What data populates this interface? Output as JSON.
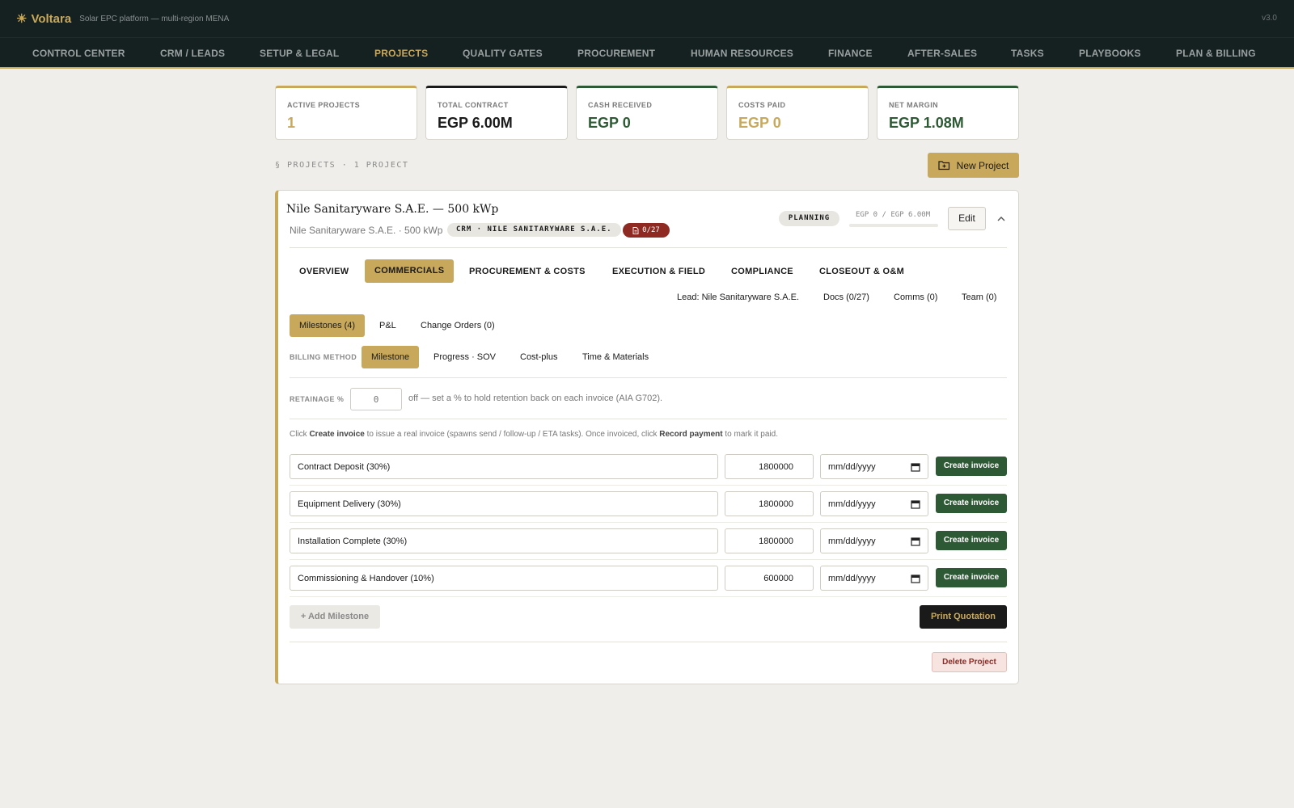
{
  "app": {
    "logo": "☀",
    "name": "Voltara",
    "subtitle": "Solar EPC platform — multi-region MENA",
    "version": "v3.0"
  },
  "nav": [
    {
      "label": "CONTROL CENTER",
      "active": false
    },
    {
      "label": "CRM / LEADS",
      "active": false
    },
    {
      "label": "SETUP & LEGAL",
      "active": false
    },
    {
      "label": "PROJECTS",
      "active": true
    },
    {
      "label": "QUALITY GATES",
      "active": false
    },
    {
      "label": "PROCUREMENT",
      "active": false
    },
    {
      "label": "HUMAN RESOURCES",
      "active": false
    },
    {
      "label": "FINANCE",
      "active": false
    },
    {
      "label": "AFTER-SALES",
      "active": false
    },
    {
      "label": "TASKS",
      "active": false
    },
    {
      "label": "PLAYBOOKS",
      "active": false
    },
    {
      "label": "PLAN & BILLING",
      "active": false
    }
  ],
  "kpis": [
    {
      "label": "ACTIVE PROJECTS",
      "value": "1",
      "accent": "#c8a85a"
    },
    {
      "label": "TOTAL CONTRACT",
      "value": "EGP 6.00M",
      "accent": "#1a1a1a"
    },
    {
      "label": "CASH RECEIVED",
      "value": "EGP 0",
      "accent": "#2d5a34"
    },
    {
      "label": "COSTS PAID",
      "value": "EGP 0",
      "accent": "#c8a85a"
    },
    {
      "label": "NET MARGIN",
      "value": "EGP 1.08M",
      "accent": "#2d5a34"
    }
  ],
  "section_label": "§ PROJECTS · 1 PROJECT",
  "new_project_label": "New Project",
  "project": {
    "title": "Nile Sanitaryware S.A.E. — 500 kWp",
    "subtitle": "Nile Sanitaryware S.A.E. · 500 kWp",
    "crm_tag": "CRM · NILE SANITARYWARE S.A.E.",
    "docs_badge": "0/27",
    "status": "PLANNING",
    "progress_text": "EGP 0 / EGP 6.00M",
    "progress_fraction": 0,
    "edit_label": "Edit"
  },
  "tabs": [
    {
      "label": "OVERVIEW",
      "active": false
    },
    {
      "label": "COMMERCIALS",
      "active": true
    },
    {
      "label": "PROCUREMENT & COSTS",
      "active": false
    },
    {
      "label": "EXECUTION & FIELD",
      "active": false
    },
    {
      "label": "COMPLIANCE",
      "active": false
    },
    {
      "label": "CLOSEOUT & O&M",
      "active": false
    }
  ],
  "quick_links": [
    "Lead: Nile Sanitaryware S.A.E.",
    "Docs (0/27)",
    "Comms (0)",
    "Team (0)"
  ],
  "subtabs": [
    {
      "label": "Milestones (4)",
      "active": true
    },
    {
      "label": "P&L",
      "active": false
    },
    {
      "label": "Change Orders (0)",
      "active": false
    }
  ],
  "billing": {
    "label": "BILLING METHOD",
    "options": [
      {
        "label": "Milestone",
        "active": true
      },
      {
        "label": "Progress · SOV",
        "active": false
      },
      {
        "label": "Cost-plus",
        "active": false
      },
      {
        "label": "Time & Materials",
        "active": false
      }
    ]
  },
  "retainage": {
    "label": "RETAINAGE %",
    "placeholder": "0",
    "note": "off — set a % to hold retention back on each invoice (AIA G702)."
  },
  "help": {
    "pre": "Click ",
    "b1": "Create invoice",
    "mid": " to issue a real invoice (spawns send / follow-up / ETA tasks). Once invoiced, click ",
    "b2": "Record payment",
    "post": " to mark it paid."
  },
  "milestones": [
    {
      "name": "Contract Deposit (30%)",
      "amount": "1800000",
      "date_placeholder": "mm/dd/yyyy",
      "action": "Create invoice"
    },
    {
      "name": "Equipment Delivery (30%)",
      "amount": "1800000",
      "date_placeholder": "mm/dd/yyyy",
      "action": "Create invoice"
    },
    {
      "name": "Installation Complete (30%)",
      "amount": "1800000",
      "date_placeholder": "mm/dd/yyyy",
      "action": "Create invoice"
    },
    {
      "name": "Commissioning & Handover (10%)",
      "amount": "600000",
      "date_placeholder": "mm/dd/yyyy",
      "action": "Create invoice"
    }
  ],
  "add_milestone_label": "+ Add Milestone",
  "print_quotation_label": "Print Quotation",
  "delete_project_label": "Delete Project"
}
